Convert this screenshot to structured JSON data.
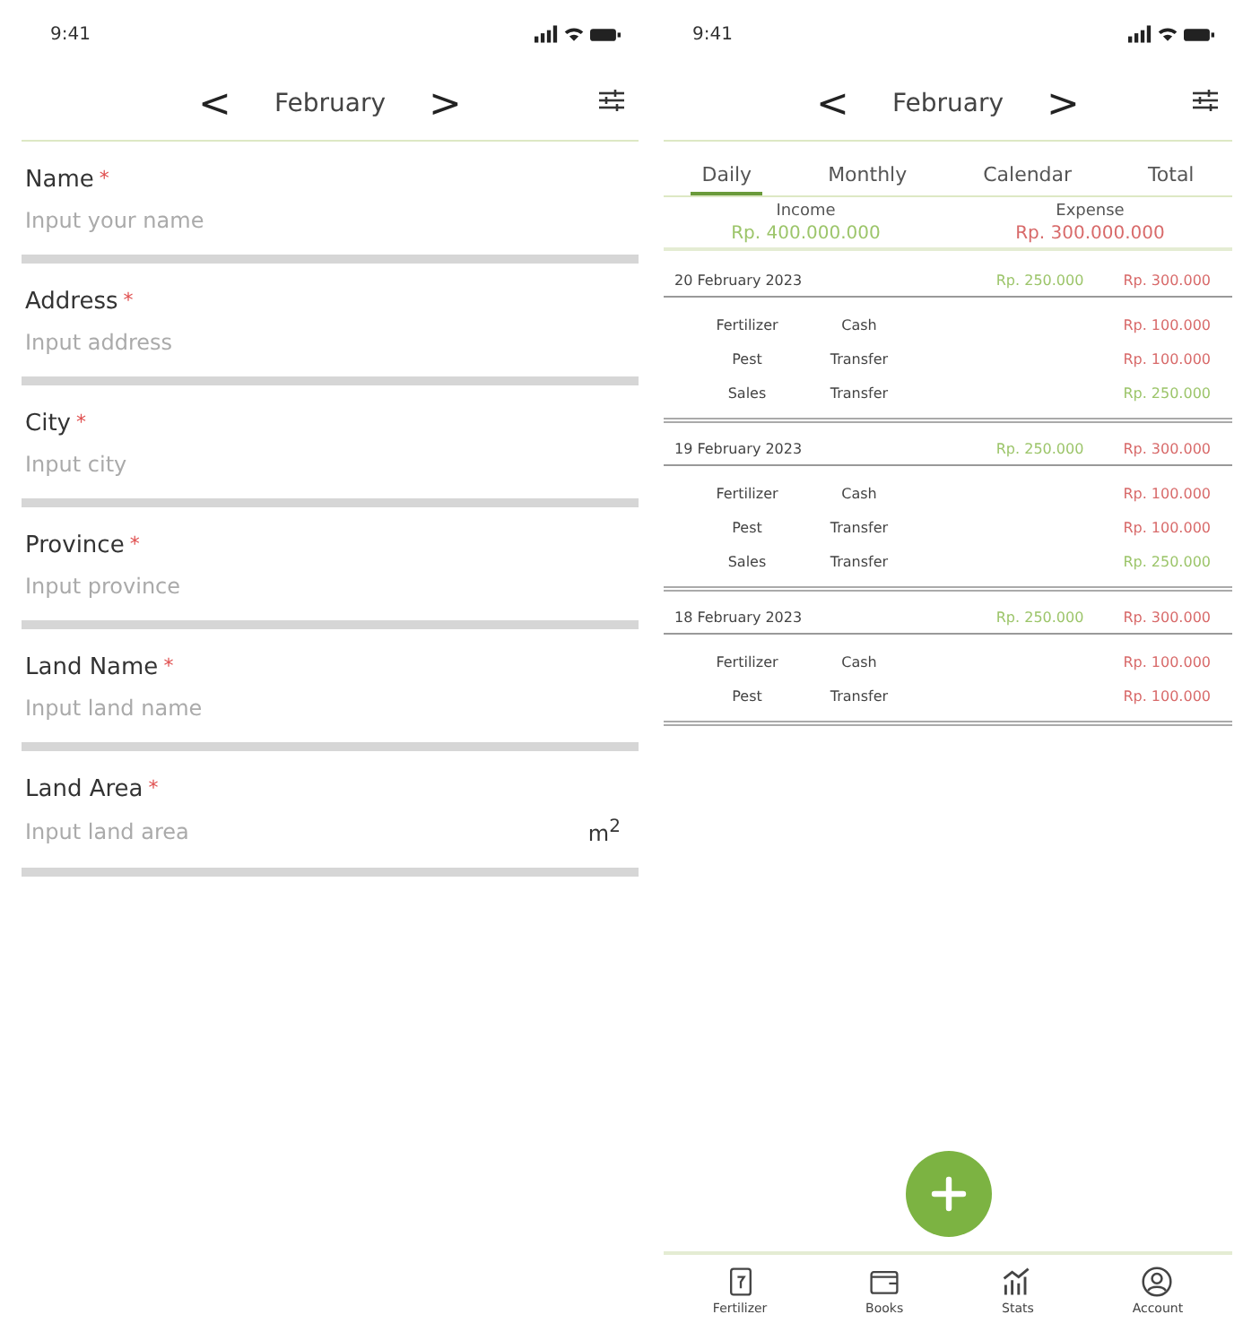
{
  "form_screen": {
    "status_bar": {
      "time": "9:41"
    },
    "header": {
      "prev": "<",
      "month": "February",
      "next": ">"
    },
    "fields": [
      {
        "label": "Name",
        "required_mark": "*",
        "placeholder": "Input your name"
      },
      {
        "label": "Address",
        "required_mark": "*",
        "placeholder": "Input address"
      },
      {
        "label": "City",
        "required_mark": "*",
        "placeholder": "Input city"
      },
      {
        "label": "Province",
        "required_mark": "*",
        "placeholder": "Input province"
      },
      {
        "label": "Land Name",
        "required_mark": "*",
        "placeholder": "Input land name"
      },
      {
        "label": "Land Area",
        "required_mark": "*",
        "placeholder": "Input land area",
        "unit": "m$^{2}$"
      }
    ]
  },
  "books_screen": {
    "status_bar": {
      "time": "9:41"
    },
    "header": {
      "prev": "<",
      "month": "February",
      "next": ">"
    },
    "tabs": [
      {
        "label": "Daily",
        "selected": true
      },
      {
        "label": "Monthly",
        "selected": false
      },
      {
        "label": "Calendar",
        "selected": false
      },
      {
        "label": "Total",
        "selected": false
      }
    ],
    "summary": [
      {
        "kind": "income",
        "label": "Income",
        "value": "Rp. 400.000.000"
      },
      {
        "kind": "expense",
        "label": "Expense",
        "value": "Rp. 300.000.000"
      }
    ],
    "days": [
      {
        "date": "20 February 2023",
        "income": "Rp. 250.000",
        "expense": "Rp. 300.000",
        "entries": [
          {
            "category": "Fertilizer",
            "account": "Cash",
            "amount": "Rp. 100.000",
            "kind": "expense"
          },
          {
            "category": "Pest",
            "account": "Transfer",
            "amount": "Rp. 100.000",
            "kind": "expense"
          },
          {
            "category": "Sales",
            "account": "Transfer",
            "amount": "Rp. 250.000",
            "kind": "income"
          }
        ]
      },
      {
        "date": "19 February 2023",
        "income": "Rp. 250.000",
        "expense": "Rp. 300.000",
        "entries": [
          {
            "category": "Fertilizer",
            "account": "Cash",
            "amount": "Rp. 100.000",
            "kind": "expense"
          },
          {
            "category": "Pest",
            "account": "Transfer",
            "amount": "Rp. 100.000",
            "kind": "expense"
          },
          {
            "category": "Sales",
            "account": "Transfer",
            "amount": "Rp. 250.000",
            "kind": "income"
          }
        ]
      },
      {
        "date": "18 February 2023",
        "income": "Rp. 250.000",
        "expense": "Rp. 300.000",
        "entries": [
          {
            "category": "Fertilizer",
            "account": "Cash",
            "amount": "Rp. 100.000",
            "kind": "expense"
          },
          {
            "category": "Pest",
            "account": "Transfer",
            "amount": "Rp. 100.000",
            "kind": "expense"
          }
        ]
      }
    ],
    "nav": [
      {
        "label": "Fertilizer",
        "kind": "fertilizer"
      },
      {
        "label": "Books",
        "kind": "books"
      },
      {
        "label": "Stats",
        "kind": "stats"
      },
      {
        "label": "Account",
        "kind": "account"
      }
    ]
  }
}
